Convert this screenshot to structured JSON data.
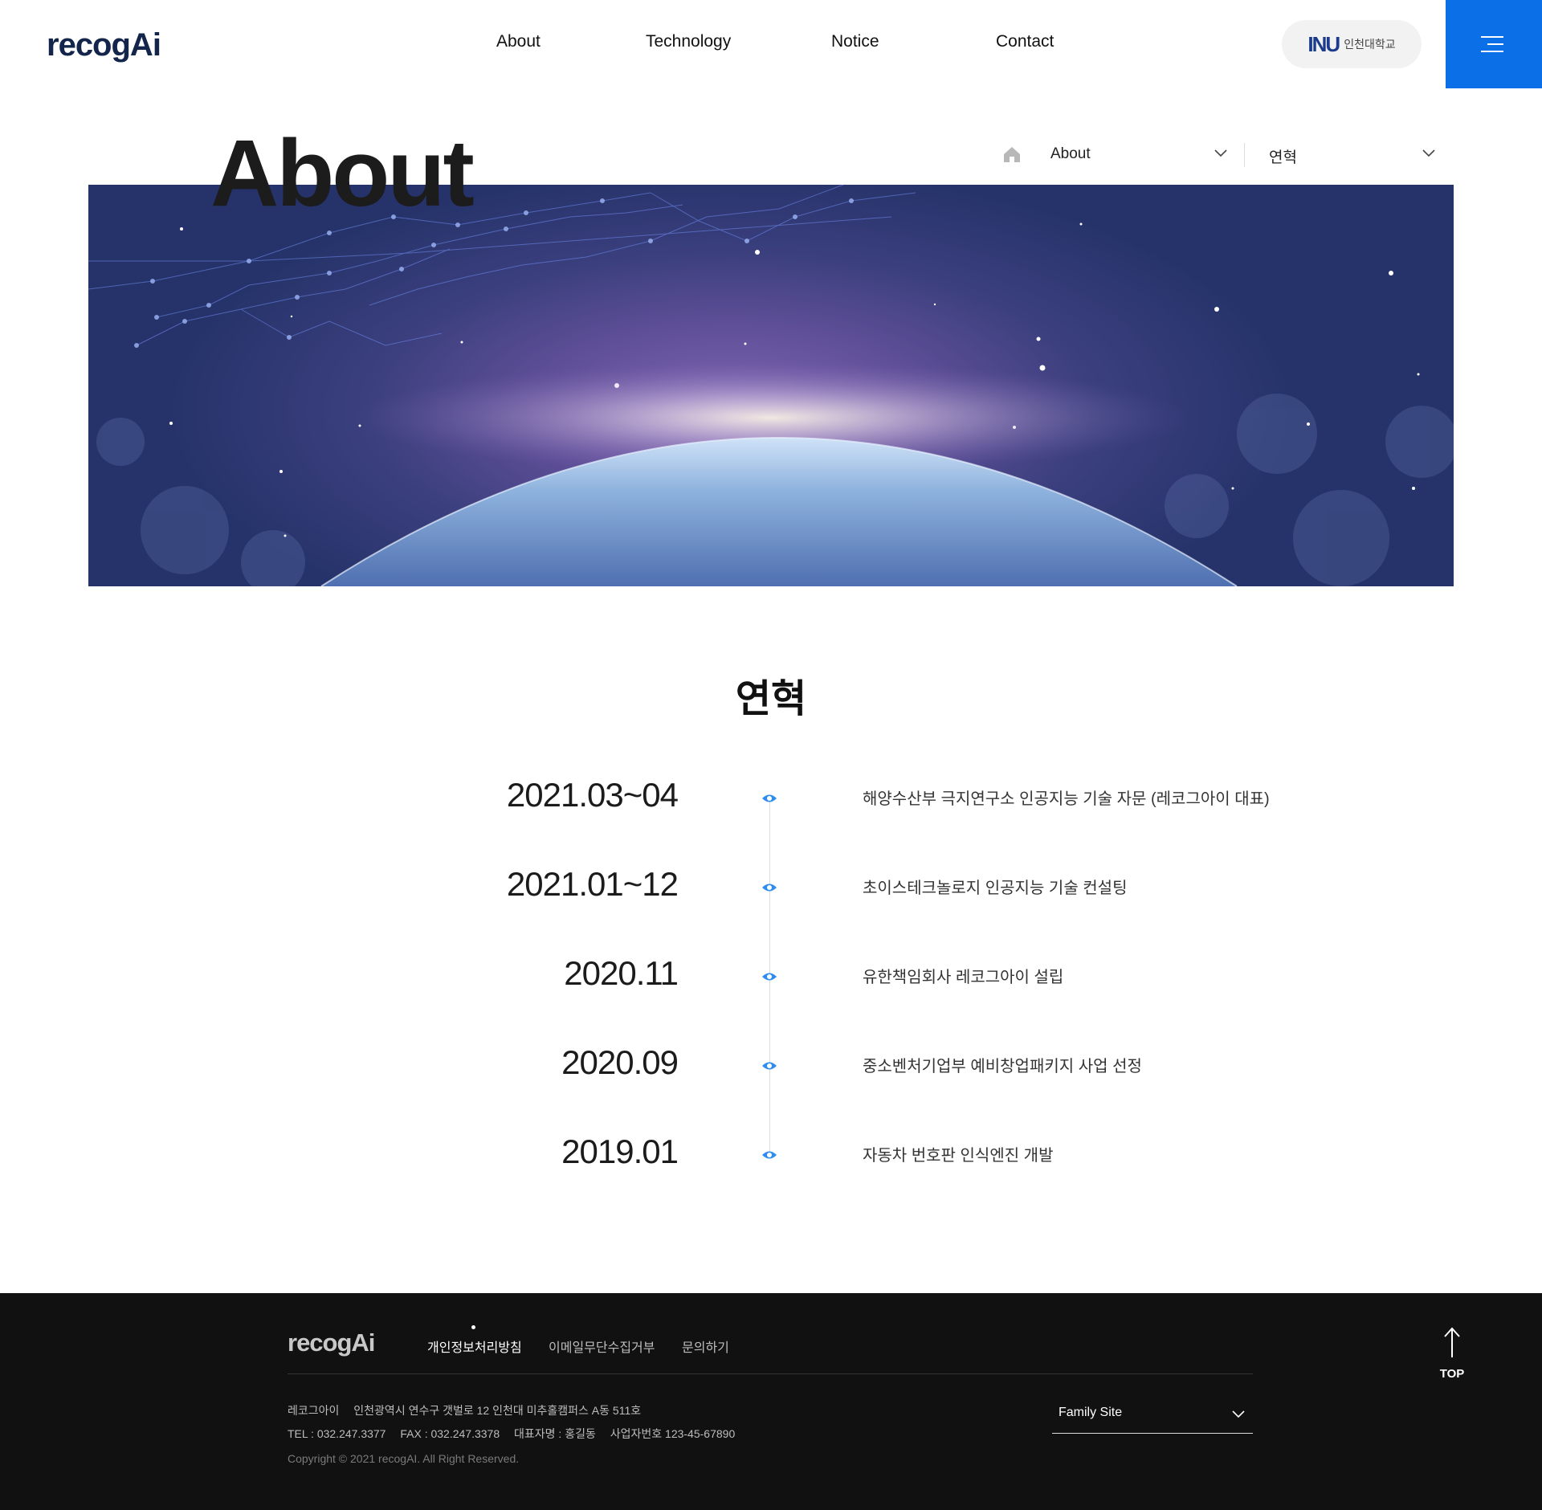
{
  "header": {
    "logo": "recogAi",
    "nav": [
      "About",
      "Technology",
      "Notice",
      "Contact"
    ],
    "university_label": "인천대학교",
    "university_mark": "INU"
  },
  "page": {
    "title": "About",
    "breadcrumb": {
      "level1": "About",
      "level2": "연혁"
    }
  },
  "history": {
    "title": "연혁",
    "items": [
      {
        "date": "2021.03~04",
        "text": "해양수산부 극지연구소 인공지능 기술 자문 (레코그아이 대표)"
      },
      {
        "date": "2021.01~12",
        "text": "초이스테크놀로지 인공지능 기술 컨설팅"
      },
      {
        "date": "2020.11",
        "text": "유한책임회사 레코그아이 설립"
      },
      {
        "date": "2020.09",
        "text": "중소벤처기업부 예비창업패키지 사업 선정"
      },
      {
        "date": "2019.01",
        "text": "자동차 번호판 인식엔진 개발"
      }
    ]
  },
  "footer": {
    "logo": "recogAi",
    "links": [
      "개인정보처리방침",
      "이메일무단수집거부",
      "문의하기"
    ],
    "company": "레코그아이",
    "address": "인천광역시 연수구 갯벌로 12 인천대 미추홀캠퍼스 A동 511호",
    "tel": "TEL : 032.247.3377",
    "fax": "FAX : 032.247.3378",
    "ceo": "대표자명 : 홍길동",
    "biz_no": "사업자번호 123-45-67890",
    "copyright": "Copyright © 2021 recogAI. All Right Reserved.",
    "family_site": "Family Site",
    "top_label": "TOP"
  },
  "colors": {
    "accent": "#0b6fe8",
    "footer_bg": "#111111",
    "brand_dark": "#13254a"
  },
  "icons": [
    "home-icon",
    "chevron-down-icon",
    "hamburger-menu-icon",
    "arrow-up-icon",
    "timeline-dot-icon"
  ]
}
